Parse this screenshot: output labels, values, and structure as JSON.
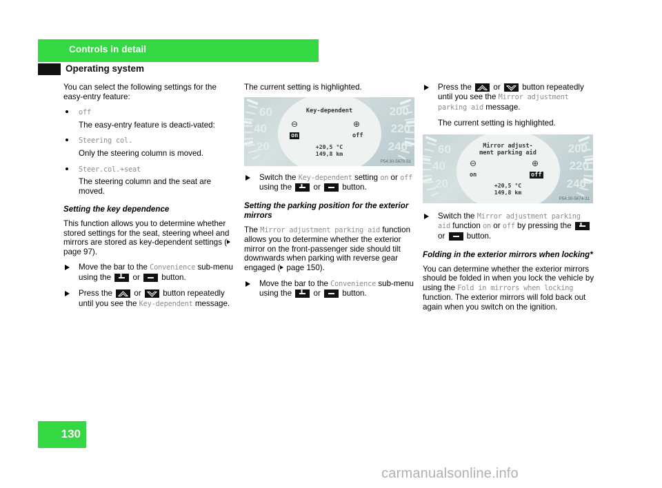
{
  "header": {
    "chapter": "Controls in detail",
    "section": "Operating system"
  },
  "page_number": "130",
  "watermark": "carmanualsonline.info",
  "column1": {
    "intro": "You can select the following settings for the easy-entry feature:",
    "bullets": [
      {
        "code": "off",
        "desc": "The easy-entry feature is deacti-vated:"
      },
      {
        "code": "Steering col.",
        "desc": "Only the steering column is moved."
      },
      {
        "code": "Steer.col.+seat",
        "desc": "The steering column and the seat are moved."
      }
    ],
    "heading": "Setting the key dependence",
    "body": "This function allows you to determine whether stored settings for the seat, steering wheel and mirrors are stored as key-dependent settings (",
    "body_ref": " page 97).",
    "step1_a": "Move the bar to the ",
    "step1_code": "Convenience",
    "step1_b": " sub-menu using the ",
    "step1_c": " or ",
    "step1_d": " button.",
    "step2_a": "Press the ",
    "step2_b": " or ",
    "step2_c": " button repeatedly until you see the ",
    "step2_code": "Key-dependent",
    "step2_d": " message."
  },
  "column2": {
    "caption": "The current setting is highlighted.",
    "figure": {
      "title": "Key-dependent",
      "left_symbol": "⊖",
      "right_symbol": "⊕",
      "left_value": "on",
      "right_value": "off",
      "highlighted": "on",
      "temperature": "+20,5 °C",
      "odometer": "149,8 km",
      "speed_left": [
        "60",
        "40",
        "20"
      ],
      "speed_right": [
        "200",
        "220",
        "240"
      ],
      "code": "P54.30-5670-31"
    },
    "step1_a": "Switch the ",
    "step1_code": "Key-dependent",
    "step1_b": " setting ",
    "step1_on": "on",
    "step1_c": " or ",
    "step1_off": "off",
    "step1_d": " using the ",
    "step1_e": " or ",
    "step1_f": " button.",
    "heading": "Setting the parking position for the exterior mirrors",
    "body_a": "The ",
    "body_code": "Mirror adjustment parking aid",
    "body_b": " function allows you to determine whether the exterior mirror on the front-passenger side should tilt downwards when parking with reverse gear engaged (",
    "body_ref": " page 150).",
    "step2_a": "Move the bar to the ",
    "step2_code": "Convenience",
    "step2_b": " sub-menu using the ",
    "step2_c": " or ",
    "step2_d": " button."
  },
  "column3": {
    "step1_a": "Press the ",
    "step1_b": " or ",
    "step1_c": " button repeatedly until you see the ",
    "step1_code": "Mirror adjustment parking aid",
    "step1_d": " message.",
    "caption": "The current setting is highlighted.",
    "figure": {
      "title_line1": "Mirror adjust-",
      "title_line2": "ment parking aid",
      "left_symbol": "⊖",
      "right_symbol": "⊕",
      "left_value": "on",
      "right_value": "off",
      "highlighted": "off",
      "temperature": "+20,5 °C",
      "odometer": "149,8 km",
      "speed_left": [
        "60",
        "40",
        "20"
      ],
      "speed_right": [
        "200",
        "220",
        "240"
      ],
      "code": "P54.30-5674-31"
    },
    "step2_a": "Switch the ",
    "step2_code": "Mirror adjustment parking aid",
    "step2_b": " function ",
    "step2_on": "on",
    "step2_c": " or ",
    "step2_off": "off",
    "step2_d": " by pressing the ",
    "step2_e": " or ",
    "step2_f": " button.",
    "heading": "Folding in the exterior mirrors when locking*",
    "body_a": "You can determine whether the exterior mirrors should be folded in when you lock the vehicle by using the ",
    "body_code": "Fold in mirrors when locking",
    "body_b": " function. The exterior mirrors will fold back out again when you switch on the ignition."
  },
  "colors": {
    "accent_green": "#33d843",
    "tab_black": "#111111",
    "mono_gray": "#8b8b8b"
  }
}
